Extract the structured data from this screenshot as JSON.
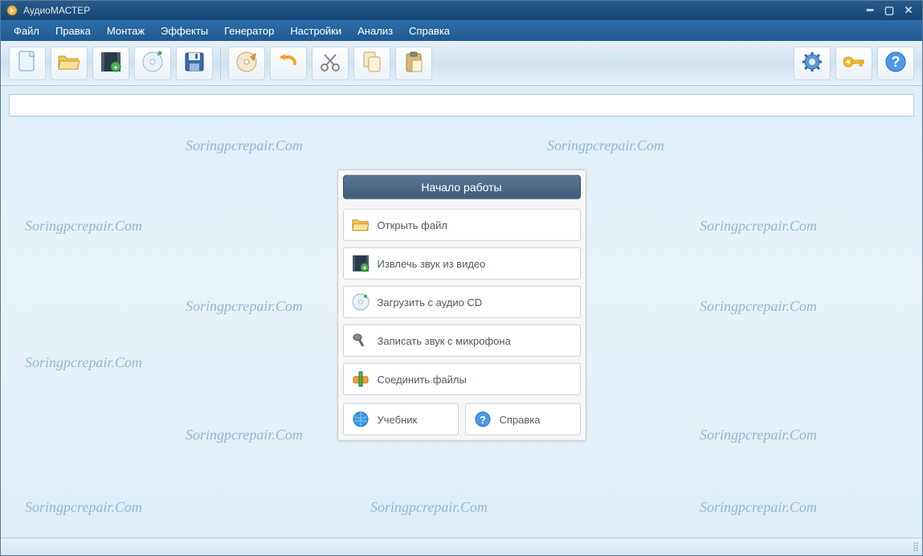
{
  "titlebar": {
    "title": "АудиоМАСТЕР"
  },
  "menu": {
    "items": [
      "Файл",
      "Правка",
      "Монтаж",
      "Эффекты",
      "Генератор",
      "Настройки",
      "Анализ",
      "Справка"
    ]
  },
  "toolbar": {
    "new": "Новый файл",
    "open": "Открыть",
    "video": "Извлечь из видео",
    "cd": "Загрузить с CD",
    "save": "Сохранить",
    "record": "Запись",
    "undo": "Отменить",
    "cut": "Вырезать",
    "copy": "Копировать",
    "paste": "Вставить",
    "settings": "Настройки",
    "key": "Активация",
    "help": "Справка"
  },
  "start_panel": {
    "header": "Начало работы",
    "open_file": "Открыть файл",
    "extract_video": "Извлечь звук из видео",
    "load_cd": "Загрузить с аудио CD",
    "record_mic": "Записать звук с микрофона",
    "join_files": "Соединить файлы",
    "tutorial": "Учебник",
    "help": "Справка"
  },
  "watermark_text": "Soringpcrepair.Com"
}
